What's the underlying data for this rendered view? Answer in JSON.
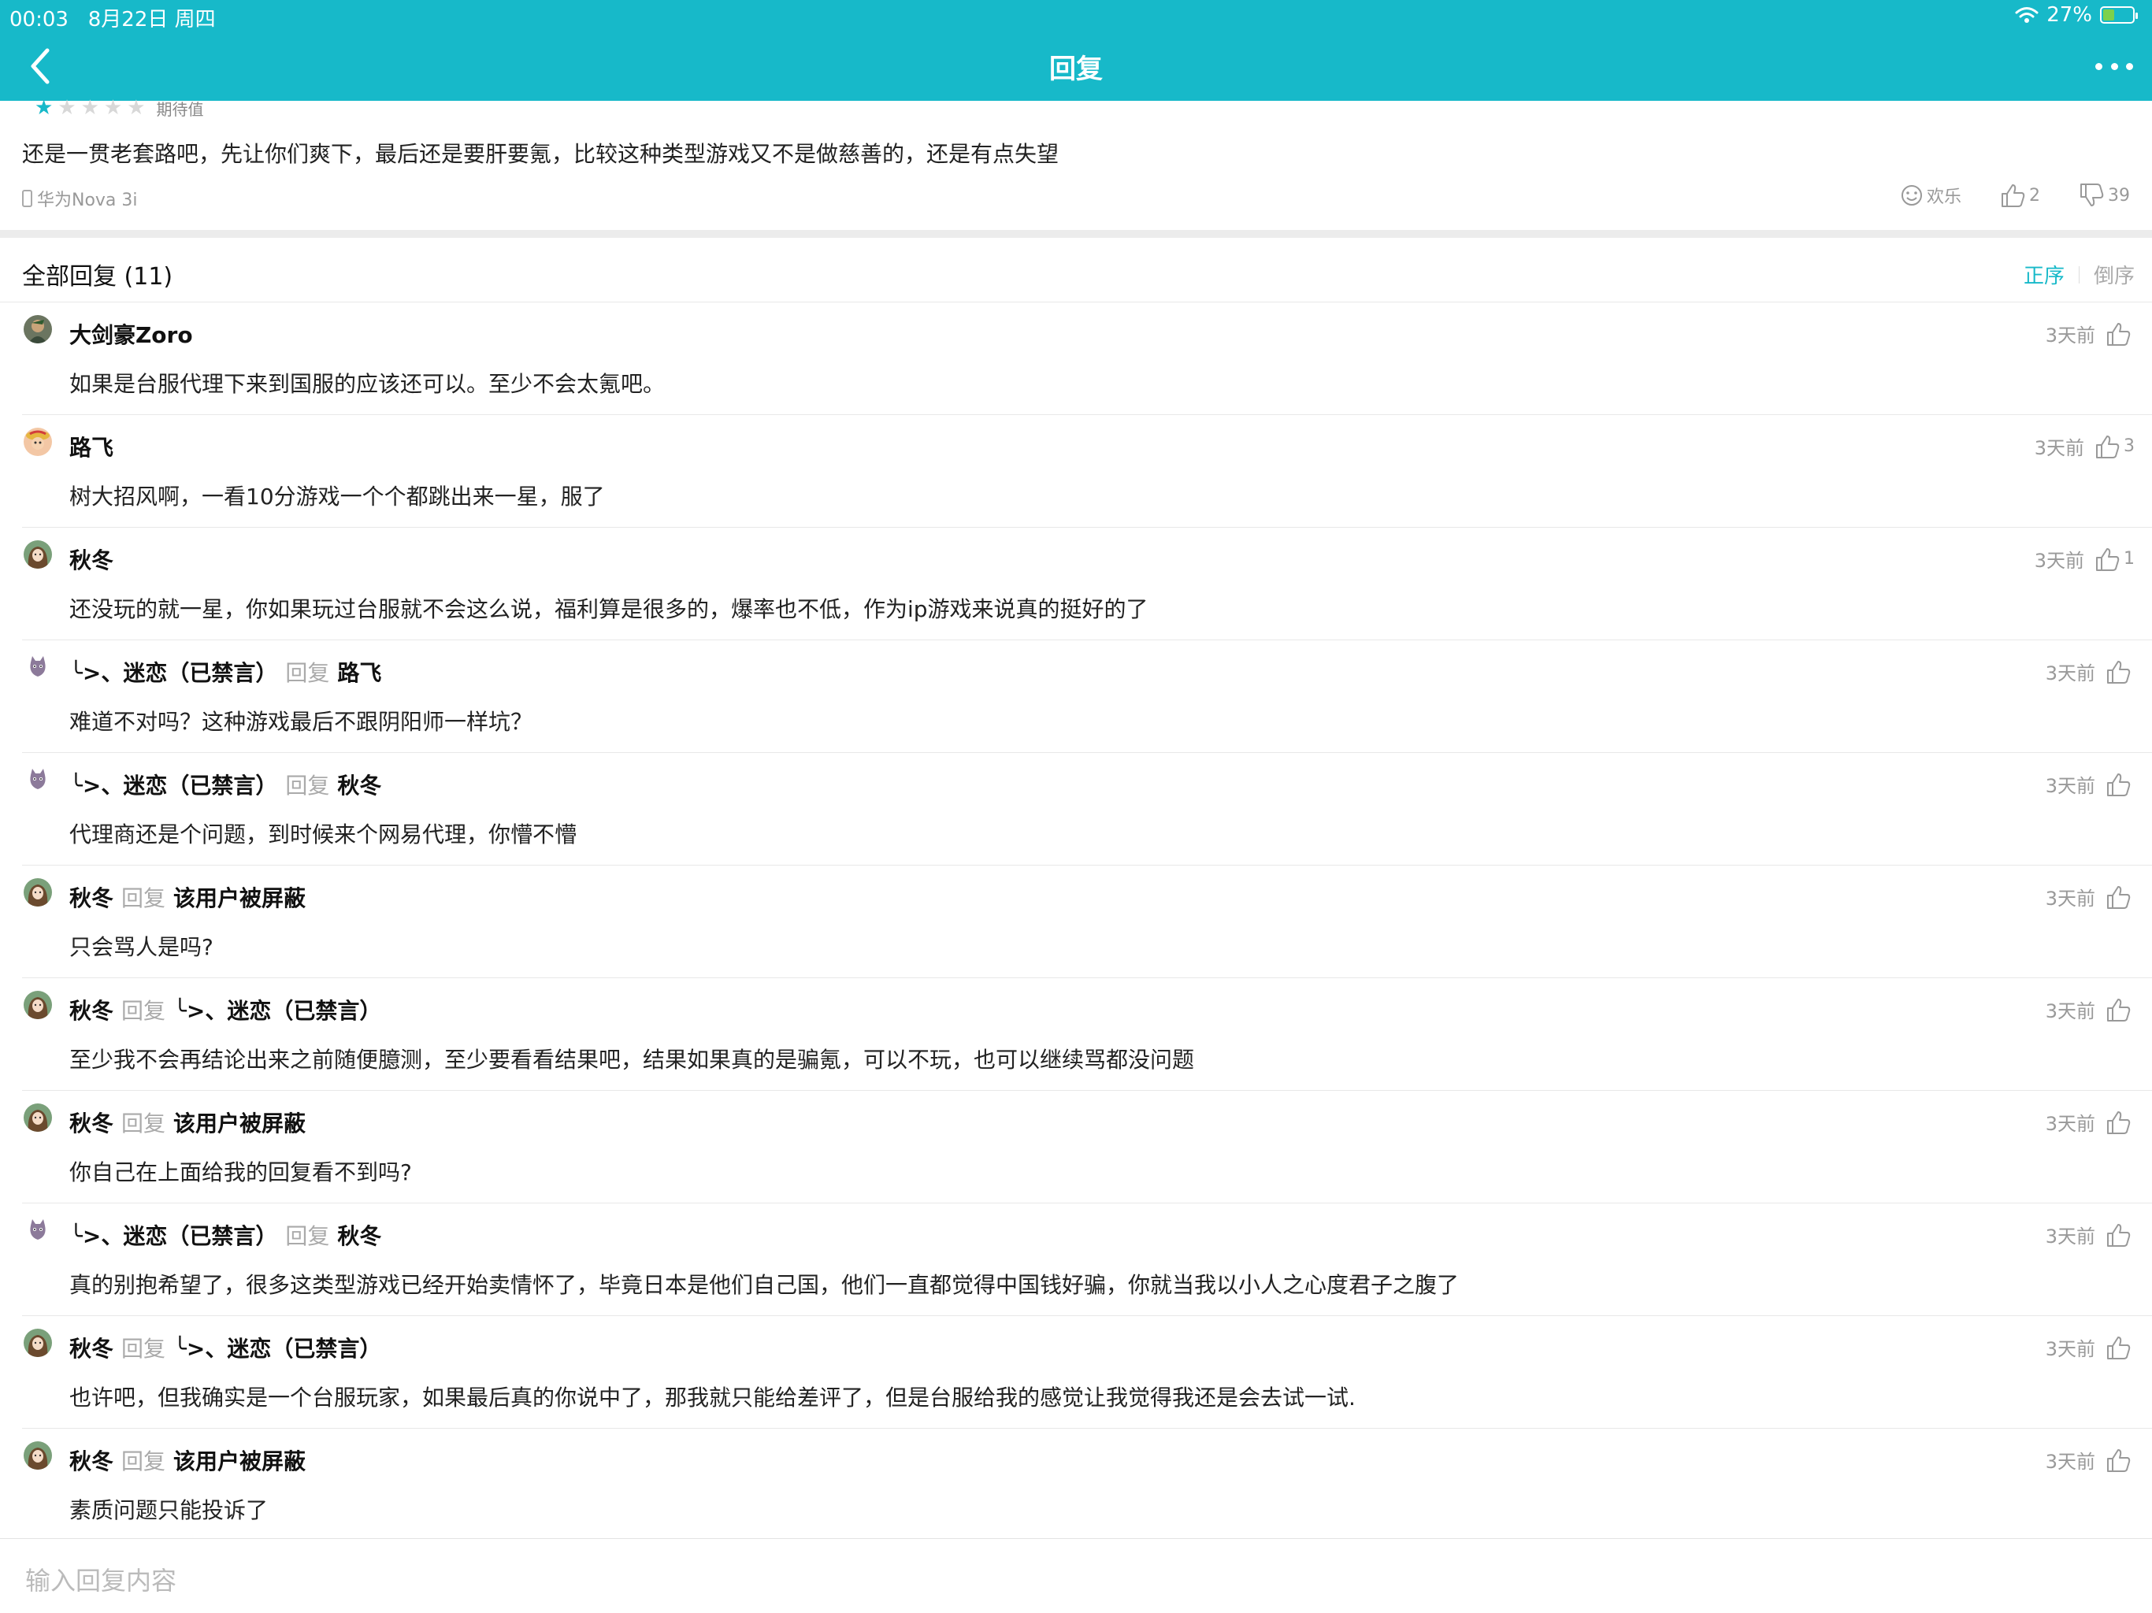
{
  "status": {
    "time": "00:03",
    "date": "8月22日 周四",
    "battery": "27%",
    "battery_level": 0.27
  },
  "nav": {
    "title": "回复"
  },
  "review": {
    "text": "还是一贯老套路吧，先让你们爽下，最后还是要肝要氪，比较这种类型游戏又不是做慈善的，还是有点失望",
    "partial_tag": "期待值",
    "rating_stars": 1,
    "device": "华为Nova 3i",
    "mood": "欢乐",
    "likes": "2",
    "dislikes": "39"
  },
  "replies_header": {
    "title": "全部回复 (11)",
    "sort_asc": "正序",
    "sort_desc": "倒序"
  },
  "reply_word": "回复",
  "replies": [
    {
      "name": "大剑豪Zoro",
      "target": "",
      "time": "3天前",
      "likes": "",
      "body": "如果是台服代理下来到国服的应该还可以。至少不会太氪吧。",
      "avatar": "zoro"
    },
    {
      "name": "路飞",
      "target": "",
      "time": "3天前",
      "likes": "3",
      "body": "树大招风啊，一看10分游戏一个个都跳出来一星，服了",
      "avatar": "luffy"
    },
    {
      "name": "秋冬",
      "target": "",
      "time": "3天前",
      "likes": "1",
      "body": "还没玩的就一星，你如果玩过台服就不会这么说，福利算是很多的，爆率也不低，作为ip游戏来说真的挺好的了",
      "avatar": "girl"
    },
    {
      "name": "╰>、迷恋（已禁言）",
      "target": "路飞",
      "time": "3天前",
      "likes": "",
      "body": "难道不对吗？这种游戏最后不跟阴阳师一样坑？",
      "avatar": "cat"
    },
    {
      "name": "╰>、迷恋（已禁言）",
      "target": "秋冬",
      "time": "3天前",
      "likes": "",
      "body": "代理商还是个问题，到时候来个网易代理，你懵不懵",
      "avatar": "cat"
    },
    {
      "name": "秋冬",
      "target": "该用户被屏蔽",
      "time": "3天前",
      "likes": "",
      "body": "只会骂人是吗?",
      "avatar": "girl"
    },
    {
      "name": "秋冬",
      "target": "╰>、迷恋（已禁言）",
      "time": "3天前",
      "likes": "",
      "body": "至少我不会再结论出来之前随便臆测，至少要看看结果吧，结果如果真的是骗氪，可以不玩，也可以继续骂都没问题",
      "avatar": "girl"
    },
    {
      "name": "秋冬",
      "target": "该用户被屏蔽",
      "time": "3天前",
      "likes": "",
      "body": "你自己在上面给我的回复看不到吗?",
      "avatar": "girl"
    },
    {
      "name": "╰>、迷恋（已禁言）",
      "target": "秋冬",
      "time": "3天前",
      "likes": "",
      "body": "真的别抱希望了，很多这类型游戏已经开始卖情怀了，毕竟日本是他们自己国，他们一直都觉得中国钱好骗，你就当我以小人之心度君子之腹了",
      "avatar": "cat"
    },
    {
      "name": "秋冬",
      "target": "╰>、迷恋（已禁言）",
      "time": "3天前",
      "likes": "",
      "body": "也许吧，但我确实是一个台服玩家，如果最后真的你说中了，那我就只能给差评了，但是台服给我的感觉让我觉得我还是会去试一试.",
      "avatar": "girl"
    },
    {
      "name": "秋冬",
      "target": "该用户被屏蔽",
      "time": "3天前",
      "likes": "",
      "body": "素质问题只能投诉了",
      "avatar": "girl"
    }
  ],
  "input": {
    "placeholder": "输入回复内容"
  },
  "colors": {
    "accent": "#17b9c9",
    "battery_fill": "#7cd14b"
  }
}
